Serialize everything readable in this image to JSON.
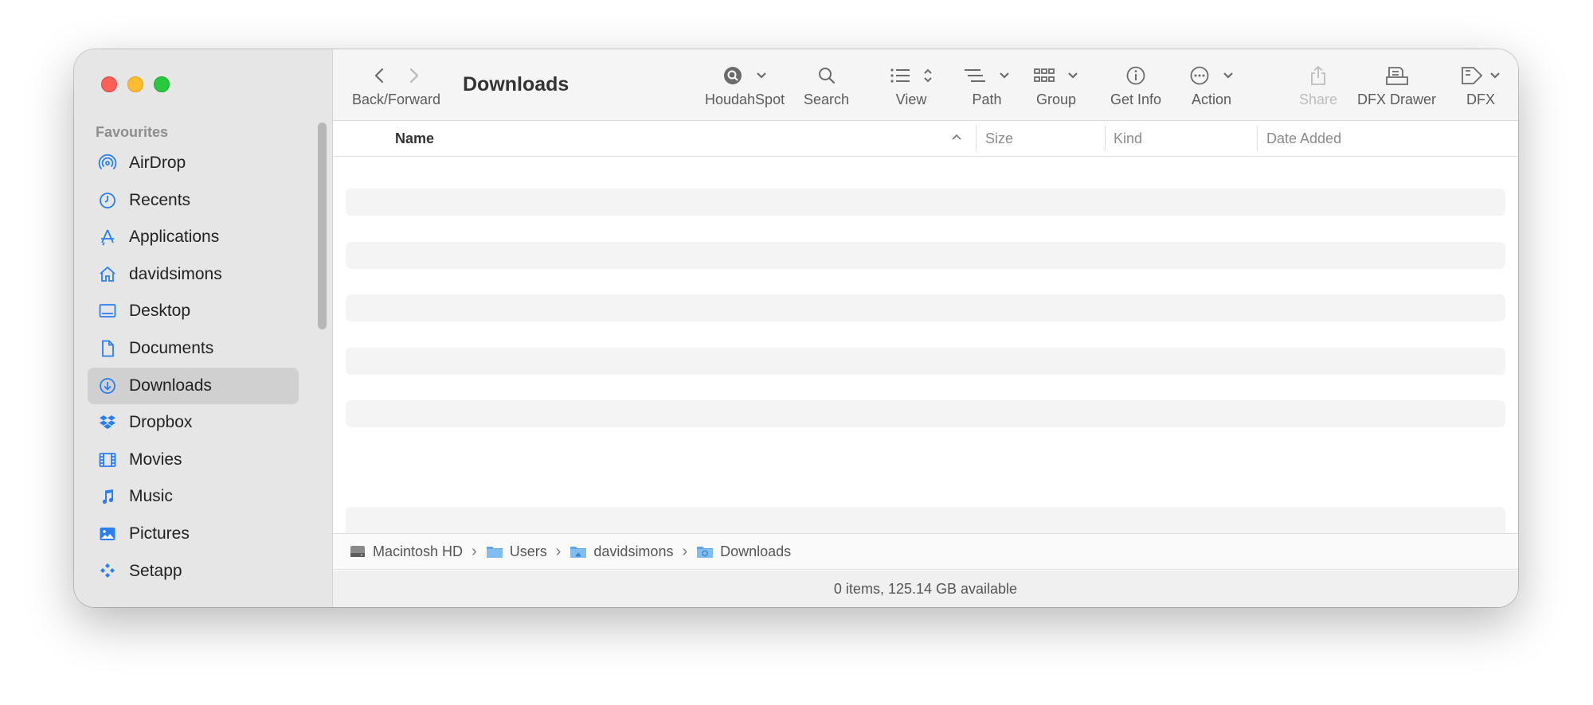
{
  "window": {
    "title": "Downloads"
  },
  "sidebar": {
    "section_heading": "Favourites",
    "items": [
      {
        "label": "AirDrop",
        "icon": "airdrop-icon"
      },
      {
        "label": "Recents",
        "icon": "clock-icon"
      },
      {
        "label": "Applications",
        "icon": "applications-icon"
      },
      {
        "label": "davidsimons",
        "icon": "home-icon"
      },
      {
        "label": "Desktop",
        "icon": "desktop-icon"
      },
      {
        "label": "Documents",
        "icon": "document-icon"
      },
      {
        "label": "Downloads",
        "icon": "download-icon",
        "selected": true
      },
      {
        "label": "Dropbox",
        "icon": "dropbox-icon"
      },
      {
        "label": "Movies",
        "icon": "film-icon"
      },
      {
        "label": "Music",
        "icon": "music-icon"
      },
      {
        "label": "Pictures",
        "icon": "pictures-icon"
      },
      {
        "label": "Setapp",
        "icon": "setapp-icon"
      }
    ]
  },
  "toolbar": {
    "back_forward_label": "Back/Forward",
    "houdahspot_label": "HoudahSpot",
    "search_label": "Search",
    "view_label": "View",
    "path_label": "Path",
    "group_label": "Group",
    "get_info_label": "Get Info",
    "action_label": "Action",
    "share_label": "Share",
    "dfx_drawer_label": "DFX Drawer",
    "dfx_label": "DFX"
  },
  "columns": {
    "name": "Name",
    "size": "Size",
    "kind": "Kind",
    "date_added": "Date Added"
  },
  "pathbar": {
    "items": [
      "Macintosh HD",
      "Users",
      "davidsimons",
      "Downloads"
    ]
  },
  "status": {
    "text": "0 items, 125.14 GB available"
  },
  "colors": {
    "accent": "#2a7ef3",
    "close": "#fe5f57",
    "minimize": "#febc2e",
    "maximize": "#28c840"
  }
}
